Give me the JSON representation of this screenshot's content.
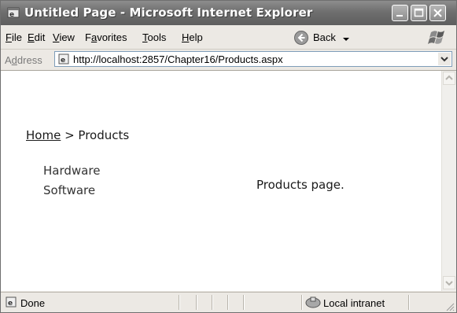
{
  "window": {
    "title": "Untitled Page - Microsoft Internet Explorer"
  },
  "menu": {
    "items": [
      {
        "pre": "",
        "acc": "F",
        "post": "ile"
      },
      {
        "pre": "",
        "acc": "E",
        "post": "dit"
      },
      {
        "pre": "",
        "acc": "V",
        "post": "iew"
      },
      {
        "pre": "F",
        "acc": "a",
        "post": "vorites"
      },
      {
        "pre": "",
        "acc": "T",
        "post": "ools"
      },
      {
        "pre": "",
        "acc": "H",
        "post": "elp"
      }
    ],
    "back_label": "Back",
    "chevron": "»"
  },
  "address": {
    "label_pre": "A",
    "label_acc": "d",
    "label_post": "dress",
    "url": "http://localhost:2857/Chapter16/Products.aspx"
  },
  "page": {
    "breadcrumb": {
      "home": "Home",
      "separator": " > ",
      "current": "Products"
    },
    "nav": [
      "Hardware",
      "Software"
    ],
    "message": "Products page."
  },
  "status": {
    "text": "Done",
    "zone": "Local intranet"
  },
  "colors": {
    "titlebar": "#6f6f6f",
    "chrome": "#ece9e4",
    "address_border": "#7f9db9"
  }
}
